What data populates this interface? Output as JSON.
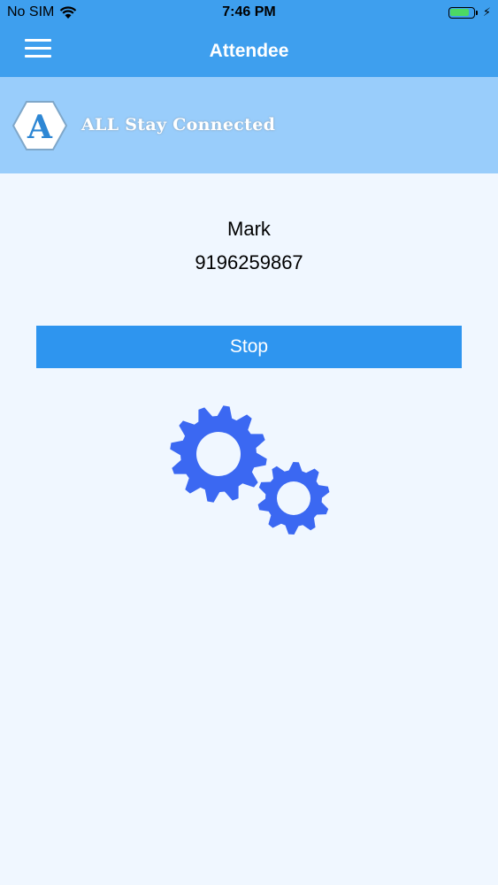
{
  "status_bar": {
    "carrier": "No SIM",
    "time": "7:46 PM",
    "battery_level": 0.85,
    "wifi_icon": "wifi-icon",
    "battery_icon": "battery-icon",
    "charging_icon": "bolt-icon"
  },
  "navbar": {
    "title": "Attendee",
    "menu_icon": "hamburger-menu-icon"
  },
  "brand": {
    "logo_letter": "A",
    "name": "ALL Stay Connected"
  },
  "attendee": {
    "name": "Mark",
    "phone": "9196259867"
  },
  "actions": {
    "stop_label": "Stop"
  },
  "activity_indicator": {
    "icon": "gears-icon"
  },
  "colors": {
    "header": "#3e9fee",
    "banner": "#99cdfb",
    "background": "#f0f7ff",
    "button": "#2e95ef",
    "gear": "#3b68f2"
  }
}
